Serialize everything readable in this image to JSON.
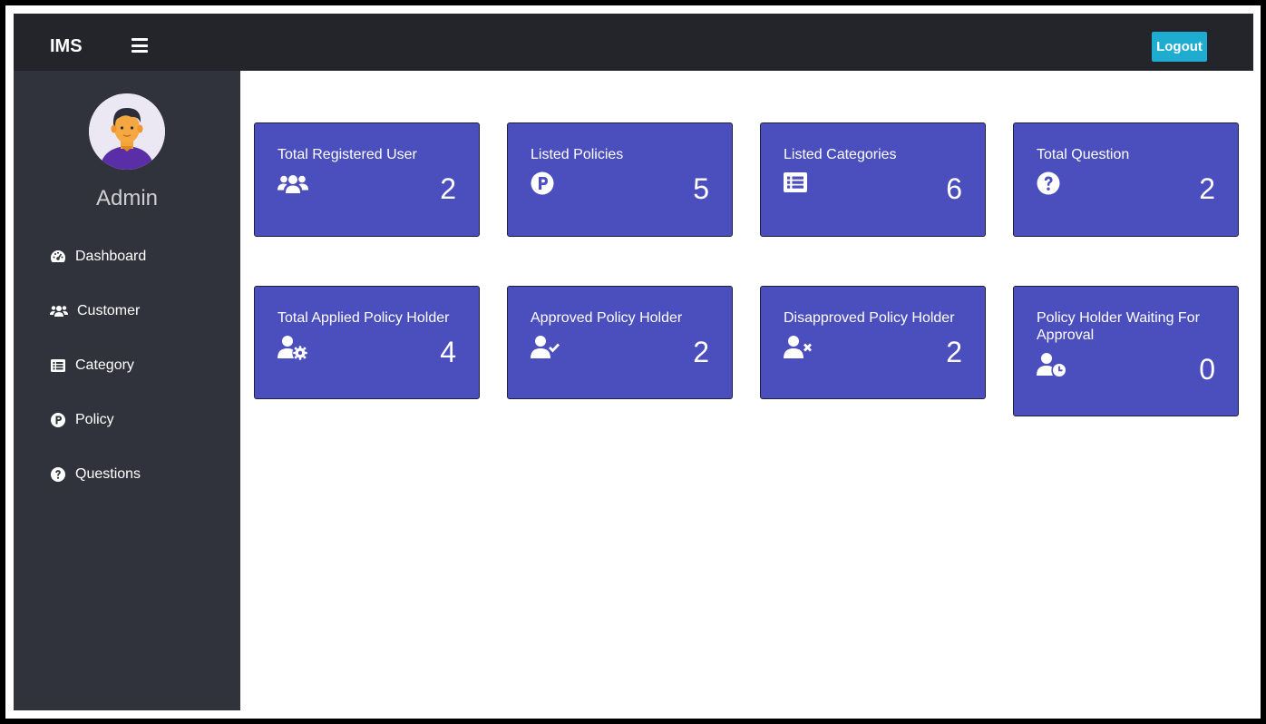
{
  "navbar": {
    "brand": "IMS",
    "logout_label": "Logout"
  },
  "sidebar": {
    "user_name": "Admin",
    "items": [
      {
        "label": "Dashboard",
        "icon": "tachometer-icon"
      },
      {
        "label": "Customer",
        "icon": "users-icon"
      },
      {
        "label": "Category",
        "icon": "list-icon"
      },
      {
        "label": "Policy",
        "icon": "parking-icon"
      },
      {
        "label": "Questions",
        "icon": "question-circle-icon"
      }
    ]
  },
  "cards": [
    {
      "title": "Total Registered User",
      "count": "2",
      "icon": "users-icon"
    },
    {
      "title": "Listed Policies",
      "count": "5",
      "icon": "parking-icon"
    },
    {
      "title": "Listed Categories",
      "count": "6",
      "icon": "list-icon"
    },
    {
      "title": "Total Question",
      "count": "2",
      "icon": "question-circle-icon"
    },
    {
      "title": "Total Applied Policy Holder",
      "count": "4",
      "icon": "user-cog-icon"
    },
    {
      "title": "Approved Policy Holder",
      "count": "2",
      "icon": "user-check-icon"
    },
    {
      "title": "Disapproved Policy Holder",
      "count": "2",
      "icon": "user-times-icon"
    },
    {
      "title": "Policy Holder Waiting For Approval",
      "count": "0",
      "icon": "user-clock-icon"
    }
  ],
  "colors": {
    "navbar": "#23252b",
    "sidebar": "#30333b",
    "card": "#4b4fbd",
    "logout": "#1eadd0"
  }
}
